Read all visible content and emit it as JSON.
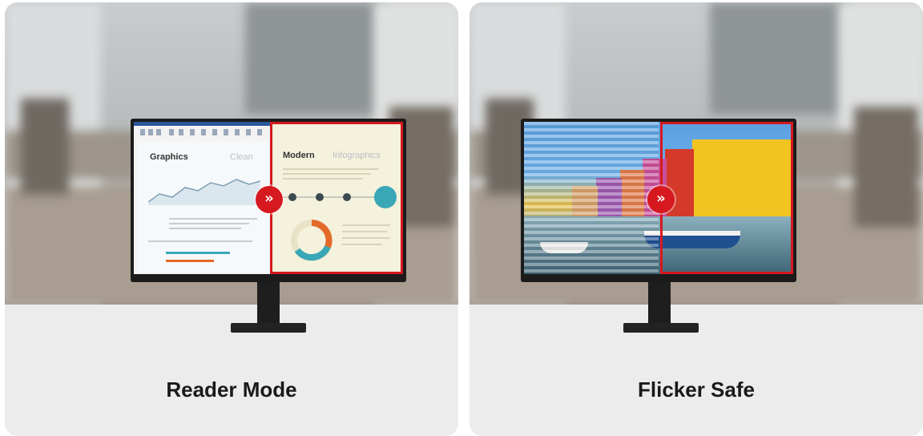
{
  "cards": [
    {
      "caption": "Reader Mode",
      "screen": {
        "left_heading": "Graphics",
        "left_subheading": "Clean",
        "right_heading": "Modern",
        "right_subheading": "Infographics"
      },
      "badge_icon": "double-chevron-right-icon"
    },
    {
      "caption": "Flicker Safe",
      "badge_icon": "double-chevron-right-icon"
    }
  ],
  "colors": {
    "accent_red": "#d6181f",
    "caption_text": "#1a1a1a",
    "card_background": "#ececec"
  }
}
